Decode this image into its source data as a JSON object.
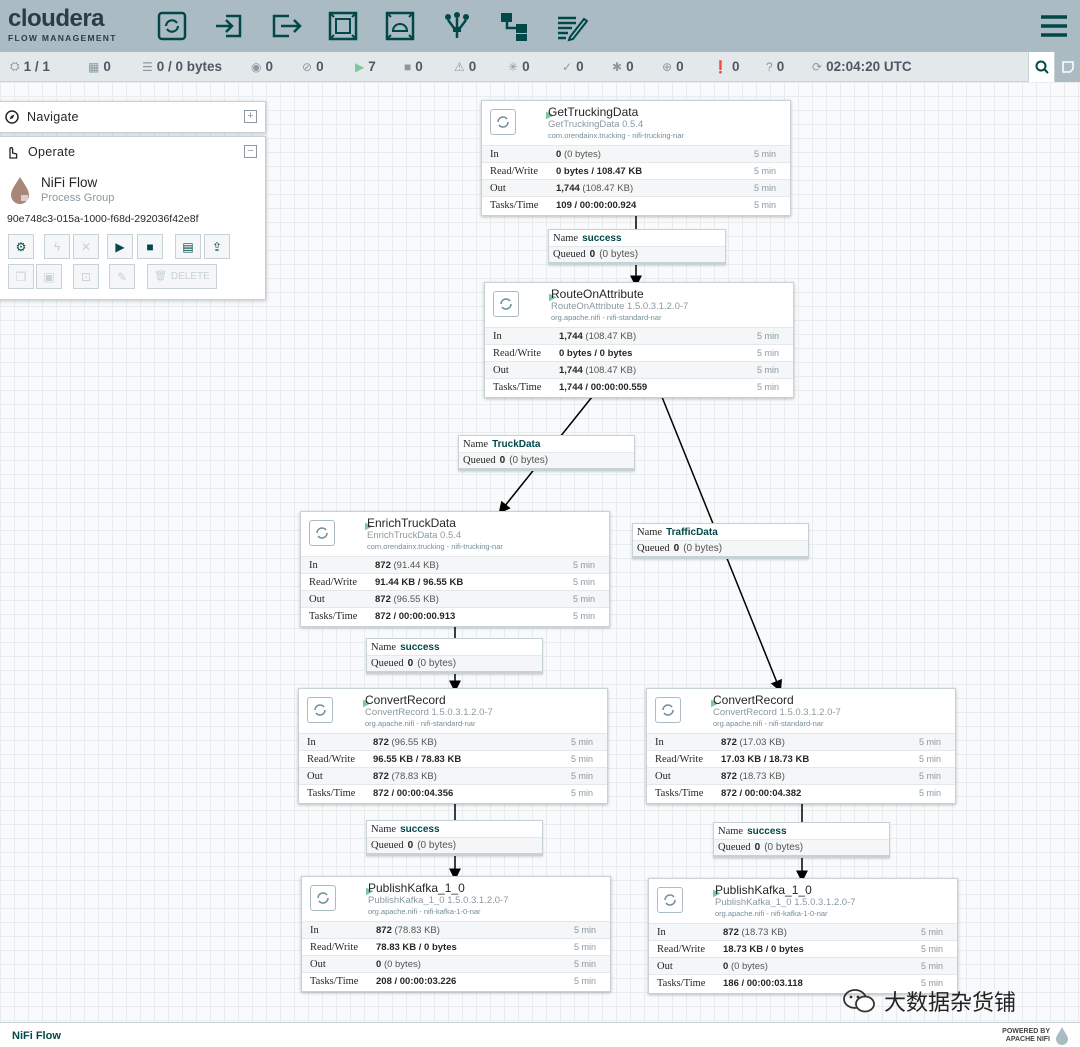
{
  "brand": {
    "name": "cloudera",
    "sub": "FLOW MANAGEMENT"
  },
  "toolbar": {
    "icons": [
      "processor-icon",
      "input-port-icon",
      "output-port-icon",
      "process-group-icon",
      "remote-process-group-icon",
      "funnel-icon",
      "template-icon",
      "label-icon"
    ],
    "menu": "hamburger-menu-icon"
  },
  "status": {
    "cluster": "1 / 1",
    "threads": "0",
    "queued": "0 / 0 bytes",
    "transmitting": "0",
    "not_transmitting": "0",
    "running": "7",
    "stopped": "0",
    "invalid": "0",
    "disabled": "0",
    "up_to_date": "0",
    "locally_modified": "0",
    "stale": "0",
    "errors": "0",
    "sync_failure": "0",
    "last_refresh": "02:04:20 UTC"
  },
  "navigate": {
    "title": "Navigate",
    "toggle": "+"
  },
  "operate": {
    "title": "Operate",
    "toggle": "−",
    "flow_name": "NiFi Flow",
    "flow_type": "Process Group",
    "flow_id": "90e748c3-015a-1000-f68d-292036f42e8f",
    "delete_label": "DELETE"
  },
  "processors": [
    {
      "name": "GetTruckingData",
      "type": "GetTruckingData 0.5.4",
      "bundle": "com.orendainx.trucking - nifi-trucking-nar",
      "in": "0",
      "in_sec": "(0 bytes)",
      "rw": "0 bytes / 108.47 KB",
      "out": "1,744",
      "out_sec": "(108.47 KB)",
      "tasks": "109 / 00:00:00.924",
      "time": "5 min"
    },
    {
      "name": "RouteOnAttribute",
      "type": "RouteOnAttribute 1.5.0.3.1.2.0-7",
      "bundle": "org.apache.nifi - nifi-standard-nar",
      "in": "1,744",
      "in_sec": "(108.47 KB)",
      "rw": "0 bytes / 0 bytes",
      "out": "1,744",
      "out_sec": "(108.47 KB)",
      "tasks": "1,744 / 00:00:00.559",
      "time": "5 min"
    },
    {
      "name": "EnrichTruckData",
      "type": "EnrichTruckData 0.5.4",
      "bundle": "com.orendainx.trucking - nifi-trucking-nar",
      "in": "872",
      "in_sec": "(91.44 KB)",
      "rw": "91.44 KB / 96.55 KB",
      "out": "872",
      "out_sec": "(96.55 KB)",
      "tasks": "872 / 00:00:00.913",
      "time": "5 min"
    },
    {
      "name": "ConvertRecord",
      "type": "ConvertRecord 1.5.0.3.1.2.0-7",
      "bundle": "org.apache.nifi - nifi-standard-nar",
      "in": "872",
      "in_sec": "(96.55 KB)",
      "rw": "96.55 KB / 78.83 KB",
      "out": "872",
      "out_sec": "(78.83 KB)",
      "tasks": "872 / 00:00:04.356",
      "time": "5 min"
    },
    {
      "name": "ConvertRecord",
      "type": "ConvertRecord 1.5.0.3.1.2.0-7",
      "bundle": "org.apache.nifi - nifi-standard-nar",
      "in": "872",
      "in_sec": "(17.03 KB)",
      "rw": "17.03 KB / 18.73 KB",
      "out": "872",
      "out_sec": "(18.73 KB)",
      "tasks": "872 / 00:00:04.382",
      "time": "5 min"
    },
    {
      "name": "PublishKafka_1_0",
      "type": "PublishKafka_1_0 1.5.0.3.1.2.0-7",
      "bundle": "org.apache.nifi - nifi-kafka-1-0-nar",
      "in": "872",
      "in_sec": "(78.83 KB)",
      "rw": "78.83 KB / 0 bytes",
      "out": "0",
      "out_sec": "(0 bytes)",
      "tasks": "208 / 00:00:03.226",
      "time": "5 min"
    },
    {
      "name": "PublishKafka_1_0",
      "type": "PublishKafka_1_0 1.5.0.3.1.2.0-7",
      "bundle": "org.apache.nifi - nifi-kafka-1-0-nar",
      "in": "872",
      "in_sec": "(18.73 KB)",
      "rw": "18.73 KB / 0 bytes",
      "out": "0",
      "out_sec": "(0 bytes)",
      "tasks": "186 / 00:00:03.118",
      "time": "5 min"
    }
  ],
  "row_labels": {
    "in": "In",
    "rw": "Read/Write",
    "out": "Out",
    "tasks": "Tasks/Time"
  },
  "conn_labels": {
    "name": "Name",
    "queued": "Queued"
  },
  "connections": [
    {
      "name": "success",
      "queued": "0",
      "queued_sec": "(0 bytes)"
    },
    {
      "name": "TruckData",
      "queued": "0",
      "queued_sec": "(0 bytes)"
    },
    {
      "name": "TrafficData",
      "queued": "0",
      "queued_sec": "(0 bytes)"
    },
    {
      "name": "success",
      "queued": "0",
      "queued_sec": "(0 bytes)"
    },
    {
      "name": "success",
      "queued": "0",
      "queued_sec": "(0 bytes)"
    },
    {
      "name": "success",
      "queued": "0",
      "queued_sec": "(0 bytes)"
    }
  ],
  "footer": {
    "breadcrumb": "NiFi Flow",
    "powered_line1": "POWERED BY",
    "powered_line2": "APACHE NIFI"
  },
  "watermark": {
    "text": "大数据杂货铺"
  },
  "colors": {
    "header": "#aabbc3",
    "accent": "#004849",
    "running": "#7dc7a0"
  }
}
